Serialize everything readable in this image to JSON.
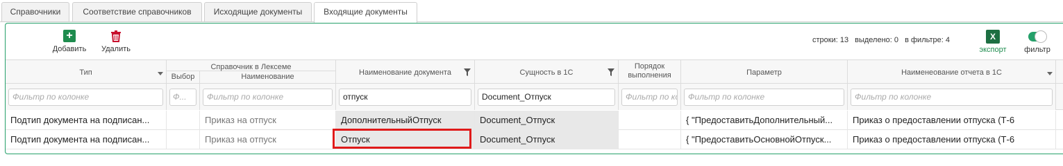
{
  "tabs": [
    "Справочники",
    "Соответствие справочников",
    "Исходящие документы",
    "Входящие документы"
  ],
  "toolbar": {
    "add_label": "Добавить",
    "delete_label": "Удалить",
    "export_label": "экспорт",
    "filter_label": "фильтр",
    "excel_glyph": "X"
  },
  "stats": {
    "rows": "строки: 13",
    "selected": "выделено: 0",
    "in_filter": "в фильтре: 4"
  },
  "grid": {
    "group_header": "Справочник в Лексеме",
    "columns": [
      "Тип",
      "Выбор",
      "Наименование",
      "Наименование документа",
      "Сущность в 1С",
      "Порядок выполнения",
      "Параметр",
      "Наименеование отчета в 1С"
    ],
    "placeholder": "Фильтр по колонке",
    "placeholder_short": "Ф...",
    "filter_values": {
      "doc_name": "отпуск",
      "entity": "Document_Отпуск"
    },
    "rows": [
      {
        "type": "Подтип документа на подписан...",
        "choice": "",
        "name": "Приказ на отпуск",
        "doc_name": "ДополнительныйОтпуск",
        "entity": "Document_Отпуск",
        "order": "",
        "param": "{ \"ПредоставитьДополнительный...",
        "report": "Приказ о предоставлении отпуска (Т-6"
      },
      {
        "type": "Подтип документа на подписан...",
        "choice": "",
        "name": "Приказ на отпуск",
        "doc_name": "Отпуск",
        "entity": "Document_Отпуск",
        "order": "",
        "param": "{ \"ПредоставитьОсновнойОтпуск...",
        "report": "Приказ о предоставлении отпуска (Т-6"
      }
    ]
  }
}
